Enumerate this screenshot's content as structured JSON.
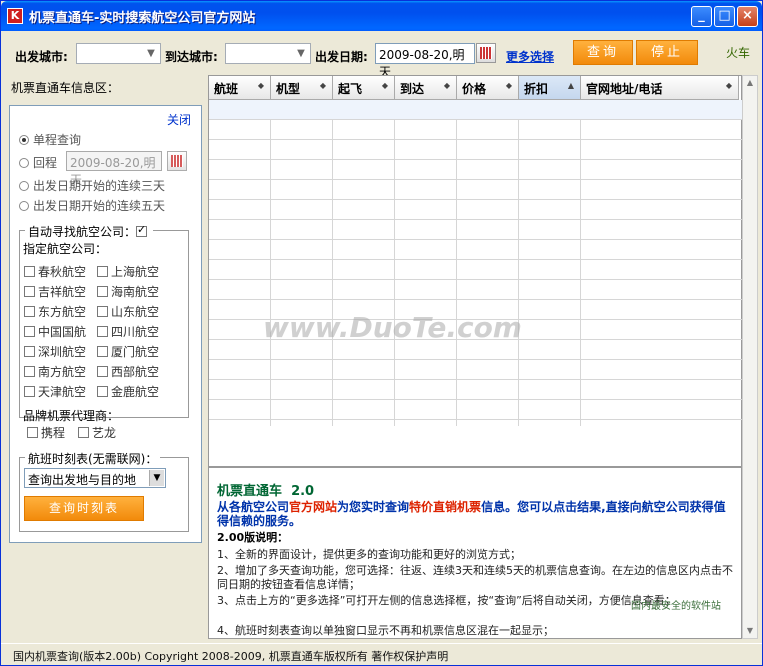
{
  "window": {
    "title": "机票直通车-实时搜索航空公司官方网站",
    "icon_letter": "K",
    "minimize": "_",
    "maximize": "□",
    "close": "×"
  },
  "toolbar": {
    "from_label": "出发城市:",
    "from_value": "",
    "to_label": "到达城市:",
    "to_value": "",
    "date_label": "出发日期:",
    "date_value": "2009-08-20,明天",
    "more_link": "更多选择",
    "query_button": "查询",
    "stop_button": "停止",
    "train_link": "火车"
  },
  "left": {
    "heading": "机票直通车信息区：",
    "close_link": "关闭",
    "one_way": "单程查询",
    "round_trip": "回程",
    "return_date": "2009-08-20,明天",
    "three_days": "出发日期开始的连续三天",
    "five_days": "出发日期开始的连续五天",
    "auto_find_label": "自动寻找航空公司：",
    "auto_find_checked": true,
    "specify_label": "指定航空公司：",
    "airlines": [
      [
        "春秋航空",
        "上海航空"
      ],
      [
        "吉祥航空",
        "海南航空"
      ],
      [
        "东方航空",
        "山东航空"
      ],
      [
        "中国国航",
        "四川航空"
      ],
      [
        "深圳航空",
        "厦门航空"
      ],
      [
        "南方航空",
        "西部航空"
      ],
      [
        "天津航空",
        "金鹿航空"
      ]
    ],
    "agents_label": "品牌机票代理商：",
    "agents": [
      "携程",
      "艺龙"
    ],
    "timetable_label": "航班时刻表(无需联网)：",
    "timetable_select": "查询出发地与目的地",
    "timetable_button": "查询时刻表"
  },
  "grid": {
    "columns": [
      "航班",
      "机型",
      "起飞",
      "到达",
      "价格",
      "折扣",
      "官网地址/电话"
    ],
    "active_column": 5,
    "rows": []
  },
  "info": {
    "title": "机票直通车",
    "version": "2.0",
    "intro_parts": [
      {
        "text": "从各航空公司",
        "red": false
      },
      {
        "text": "官方网站",
        "red": true
      },
      {
        "text": "为您实时查询",
        "red": false
      },
      {
        "text": "特价直销机票",
        "red": true
      },
      {
        "text": "信息。您可以点击结果,直接向航空公司获得值得信赖的服务。",
        "red": false
      }
    ],
    "notes_title": "2.00版说明：",
    "notes": [
      "1、全新的界面设计，提供更多的查询功能和更好的浏览方式；",
      "2、增加了多天查询功能，您可选择：往返、连续3天和连续5天的机票信息查询。在左边的信息区内点击不同日期的按钮查看信息详情；",
      "3、点击上方的“更多选择”可打开左侧的信息选择框，按“查询”后将自动关闭，方便信息查看；",
      "4、航班时刻表查询以单独窗口显示不再和机票信息区混在一起显示；"
    ]
  },
  "status": {
    "text": "国内机票查询(版本2.00b)   Copyright 2008-2009, 机票直通车版权所有  著作权保护声明"
  },
  "watermark": {
    "main": "www.DuoTe.com",
    "corner": "国内最安全的软件站"
  }
}
